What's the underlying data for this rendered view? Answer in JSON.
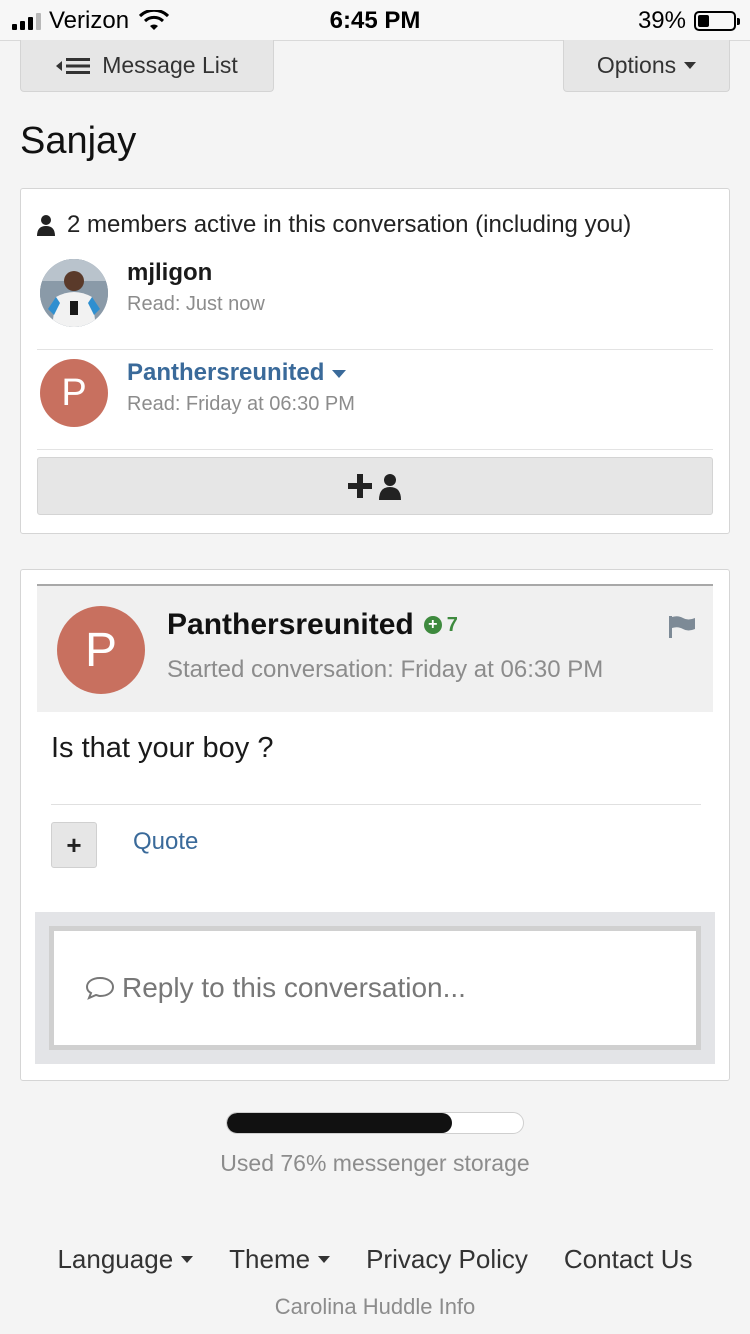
{
  "status_bar": {
    "carrier": "Verizon",
    "time": "6:45 PM",
    "battery_text": "39%",
    "battery_level": 0.39
  },
  "nav": {
    "message_list_label": "Message List",
    "options_label": "Options"
  },
  "conversation": {
    "title": "Sanjay"
  },
  "members": {
    "header": "2 members active in this conversation (including you)",
    "list": [
      {
        "name": "mjligon",
        "read": "Read: Just now"
      },
      {
        "name": "Panthersreunited",
        "read": "Read: Friday at 06:30 PM",
        "avatar_letter": "P"
      }
    ]
  },
  "post": {
    "author": "Panthersreunited",
    "avatar_letter": "P",
    "reputation": "7",
    "meta": "Started conversation: Friday at 06:30 PM",
    "body": "Is that your boy ?",
    "rep_button": "+",
    "quote_label": "Quote"
  },
  "reply": {
    "placeholder": "Reply to this conversation..."
  },
  "storage": {
    "used_fraction": 0.76,
    "text": "Used 76% messenger storage"
  },
  "footer": {
    "links": [
      "Language",
      "Theme",
      "Privacy Policy",
      "Contact Us"
    ],
    "site": "Carolina Huddle Info"
  },
  "colors": {
    "avatar": "#c8705f",
    "link": "#3a6a9a",
    "reputation": "#3e8a3e"
  }
}
